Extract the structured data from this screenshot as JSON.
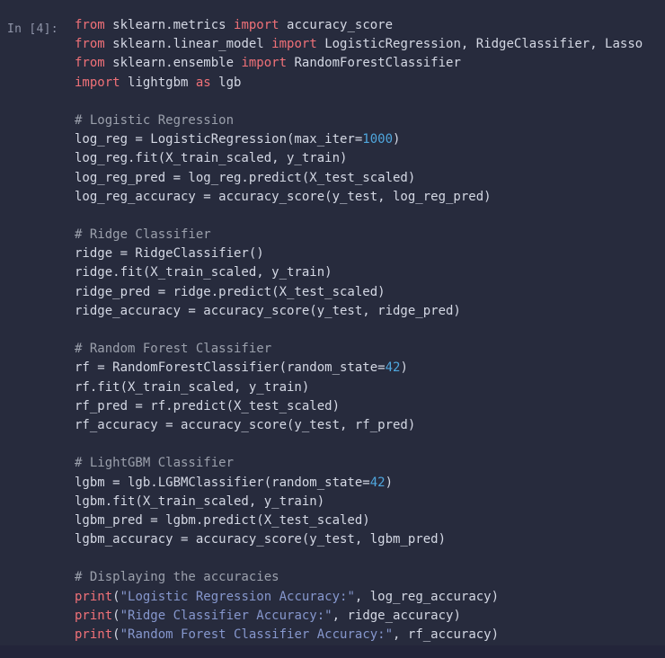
{
  "notebook": {
    "theme": {
      "background": "#272b3d",
      "bottom_band": "#23253a",
      "default_text": "#d4d8e4",
      "keyword": "#f07178",
      "number": "#4fa6dd",
      "string": "#8697cd",
      "comment": "#9ba0ac",
      "prompt": "#8f94a8"
    },
    "cell": {
      "prompt_label": "In [4]:",
      "execution_count": 4,
      "cell_type": "code",
      "language": "python",
      "lines": [
        [
          {
            "t": "from ",
            "c": "kw"
          },
          {
            "t": "sklearn.metrics ",
            "c": "id"
          },
          {
            "t": "import ",
            "c": "kw"
          },
          {
            "t": "accuracy_score",
            "c": "id"
          }
        ],
        [
          {
            "t": "from ",
            "c": "kw"
          },
          {
            "t": "sklearn.linear_model ",
            "c": "id"
          },
          {
            "t": "import ",
            "c": "kw"
          },
          {
            "t": "LogisticRegression, RidgeClassifier, Lasso",
            "c": "id"
          }
        ],
        [
          {
            "t": "from ",
            "c": "kw"
          },
          {
            "t": "sklearn.ensemble ",
            "c": "id"
          },
          {
            "t": "import ",
            "c": "kw"
          },
          {
            "t": "RandomForestClassifier",
            "c": "id"
          }
        ],
        [
          {
            "t": "import ",
            "c": "kw"
          },
          {
            "t": "lightgbm ",
            "c": "id"
          },
          {
            "t": "as ",
            "c": "kw"
          },
          {
            "t": "lgb",
            "c": "id"
          }
        ],
        [],
        [
          {
            "t": "# Logistic Regression",
            "c": "com"
          }
        ],
        [
          {
            "t": "log_reg = LogisticRegression(max_iter=",
            "c": "id"
          },
          {
            "t": "1000",
            "c": "num"
          },
          {
            "t": ")",
            "c": "punc"
          }
        ],
        [
          {
            "t": "log_reg.fit(X_train_scaled, y_train)",
            "c": "id"
          }
        ],
        [
          {
            "t": "log_reg_pred = log_reg.predict(X_test_scaled)",
            "c": "id"
          }
        ],
        [
          {
            "t": "log_reg_accuracy = accuracy_score(y_test, log_reg_pred)",
            "c": "id"
          }
        ],
        [],
        [
          {
            "t": "# Ridge Classifier",
            "c": "com"
          }
        ],
        [
          {
            "t": "ridge = RidgeClassifier()",
            "c": "id"
          }
        ],
        [
          {
            "t": "ridge.fit(X_train_scaled, y_train)",
            "c": "id"
          }
        ],
        [
          {
            "t": "ridge_pred = ridge.predict(X_test_scaled)",
            "c": "id"
          }
        ],
        [
          {
            "t": "ridge_accuracy = accuracy_score(y_test, ridge_pred)",
            "c": "id"
          }
        ],
        [],
        [
          {
            "t": "# Random Forest Classifier",
            "c": "com"
          }
        ],
        [
          {
            "t": "rf = RandomForestClassifier(random_state=",
            "c": "id"
          },
          {
            "t": "42",
            "c": "num"
          },
          {
            "t": ")",
            "c": "punc"
          }
        ],
        [
          {
            "t": "rf.fit(X_train_scaled, y_train)",
            "c": "id"
          }
        ],
        [
          {
            "t": "rf_pred = rf.predict(X_test_scaled)",
            "c": "id"
          }
        ],
        [
          {
            "t": "rf_accuracy = accuracy_score(y_test, rf_pred)",
            "c": "id"
          }
        ],
        [],
        [
          {
            "t": "# LightGBM Classifier",
            "c": "com"
          }
        ],
        [
          {
            "t": "lgbm = lgb.LGBMClassifier(random_state=",
            "c": "id"
          },
          {
            "t": "42",
            "c": "num"
          },
          {
            "t": ")",
            "c": "punc"
          }
        ],
        [
          {
            "t": "lgbm.fit(X_train_scaled, y_train)",
            "c": "id"
          }
        ],
        [
          {
            "t": "lgbm_pred = lgbm.predict(X_test_scaled)",
            "c": "id"
          }
        ],
        [
          {
            "t": "lgbm_accuracy = accuracy_score(y_test, lgbm_pred)",
            "c": "id"
          }
        ],
        [],
        [
          {
            "t": "# Displaying the accuracies",
            "c": "com"
          }
        ],
        [
          {
            "t": "print",
            "c": "fn"
          },
          {
            "t": "(",
            "c": "punc"
          },
          {
            "t": "\"Logistic Regression Accuracy:\"",
            "c": "str"
          },
          {
            "t": ", log_reg_accuracy)",
            "c": "id"
          }
        ],
        [
          {
            "t": "print",
            "c": "fn"
          },
          {
            "t": "(",
            "c": "punc"
          },
          {
            "t": "\"Ridge Classifier Accuracy:\"",
            "c": "str"
          },
          {
            "t": ", ridge_accuracy)",
            "c": "id"
          }
        ],
        [
          {
            "t": "print",
            "c": "fn"
          },
          {
            "t": "(",
            "c": "punc"
          },
          {
            "t": "\"Random Forest Classifier Accuracy:\"",
            "c": "str"
          },
          {
            "t": ", rf_accuracy)",
            "c": "id"
          }
        ]
      ]
    }
  }
}
